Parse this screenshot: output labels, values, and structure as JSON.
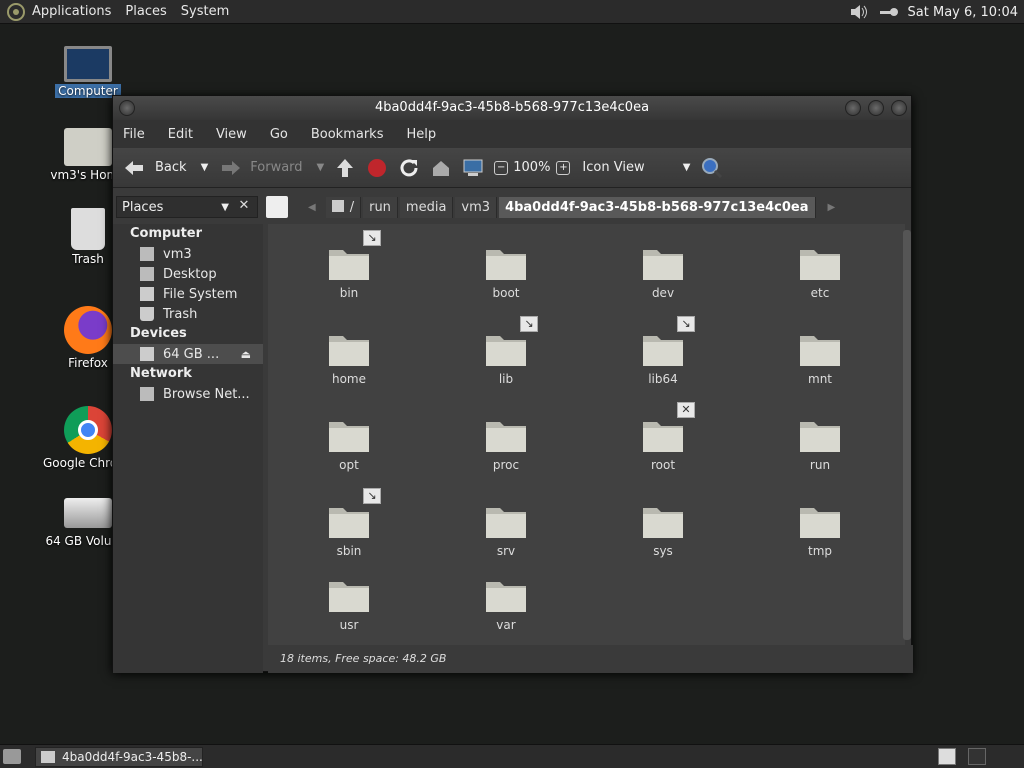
{
  "panel": {
    "menus": [
      "Applications",
      "Places",
      "System"
    ],
    "clock": "Sat May  6, 10:04"
  },
  "desktop": [
    {
      "label": "Computer",
      "icon": "monitor-icon"
    },
    {
      "label": "vm3's Home",
      "icon": "home-folder-icon"
    },
    {
      "label": "Trash",
      "icon": "trash-icon"
    },
    {
      "label": "Firefox",
      "icon": "firefox-icon"
    },
    {
      "label": "Google Chrome",
      "icon": "chrome-icon"
    },
    {
      "label": "64 GB Volume",
      "icon": "drive-icon"
    }
  ],
  "window": {
    "title": "4ba0dd4f-9ac3-45b8-b568-977c13e4c0ea",
    "menubar": [
      "File",
      "Edit",
      "View",
      "Go",
      "Bookmarks",
      "Help"
    ],
    "toolbar": {
      "back": "Back",
      "forward": "Forward",
      "zoom": "100%",
      "view_mode": "Icon View"
    },
    "side_pane_selector": "Places",
    "crumbs": [
      "/",
      "run",
      "media",
      "vm3",
      "4ba0dd4f-9ac3-45b8-b568-977c13e4c0ea"
    ],
    "sidebar": {
      "computer_header": "Computer",
      "computer_items": [
        "vm3",
        "Desktop",
        "File System",
        "Trash"
      ],
      "devices_header": "Devices",
      "device_items": [
        "64 GB ..."
      ],
      "network_header": "Network",
      "network_items": [
        "Browse Net..."
      ]
    },
    "files": [
      {
        "name": "bin",
        "emblem": "link"
      },
      {
        "name": "boot",
        "emblem": ""
      },
      {
        "name": "dev",
        "emblem": ""
      },
      {
        "name": "etc",
        "emblem": ""
      },
      {
        "name": "home",
        "emblem": ""
      },
      {
        "name": "lib",
        "emblem": "link"
      },
      {
        "name": "lib64",
        "emblem": "link"
      },
      {
        "name": "mnt",
        "emblem": ""
      },
      {
        "name": "opt",
        "emblem": ""
      },
      {
        "name": "proc",
        "emblem": ""
      },
      {
        "name": "root",
        "emblem": "noaccess"
      },
      {
        "name": "run",
        "emblem": ""
      },
      {
        "name": "sbin",
        "emblem": "link"
      },
      {
        "name": "srv",
        "emblem": ""
      },
      {
        "name": "sys",
        "emblem": ""
      },
      {
        "name": "tmp",
        "emblem": ""
      },
      {
        "name": "usr",
        "emblem": ""
      },
      {
        "name": "var",
        "emblem": ""
      }
    ],
    "status": "18 items, Free space: 48.2 GB"
  },
  "taskbar": {
    "task_label": "4ba0dd4f-9ac3-45b8-..."
  }
}
